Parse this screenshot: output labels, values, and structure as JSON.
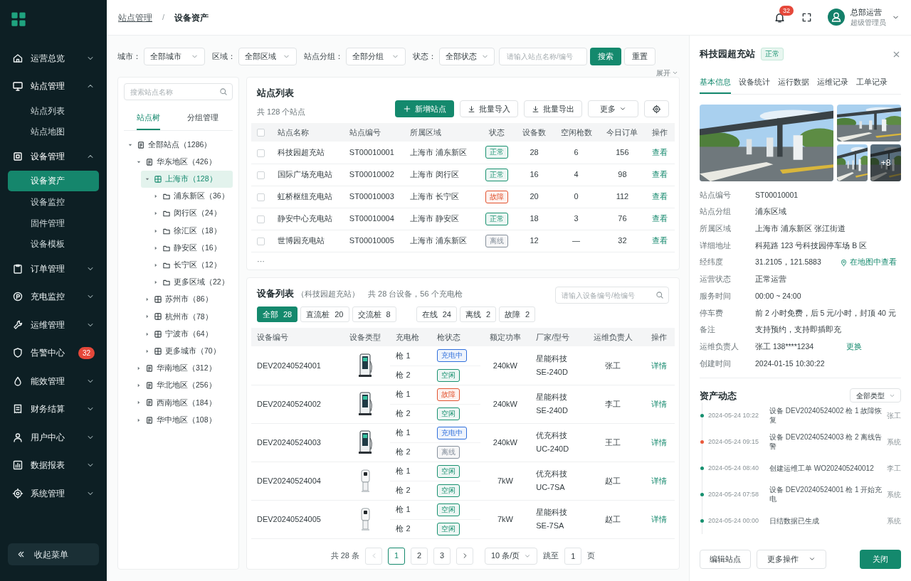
{
  "sidebar": {
    "items": [
      {
        "label": "运营总览",
        "expanded": false
      },
      {
        "label": "站点管理",
        "expanded": true,
        "children": [
          {
            "label": "站点列表",
            "selected": false
          },
          {
            "label": "站点地图",
            "selected": false
          }
        ]
      },
      {
        "label": "设备管理",
        "expanded": true,
        "children": [
          {
            "label": "设备资产",
            "selected": true
          },
          {
            "label": "设备监控",
            "selected": false
          },
          {
            "label": "固件管理",
            "selected": false
          },
          {
            "label": "设备模板",
            "selected": false
          }
        ]
      },
      {
        "label": "订单管理",
        "expanded": false
      },
      {
        "label": "充电监控",
        "expanded": false
      },
      {
        "label": "运维管理",
        "expanded": false
      },
      {
        "label": "告警中心",
        "badge": "32"
      },
      {
        "label": "能效管理",
        "expanded": false
      },
      {
        "label": "财务结算",
        "expanded": false
      },
      {
        "label": "用户中心",
        "expanded": false
      },
      {
        "label": "数据报表",
        "expanded": false
      },
      {
        "label": "系统管理",
        "expanded": false
      }
    ],
    "collapse_label": "收起菜单"
  },
  "header": {
    "breadcrumb": [
      "站点管理",
      "设备资产"
    ],
    "separator": "/",
    "notification_count": "32",
    "user": {
      "name": "总部运营",
      "role": "超级管理员"
    }
  },
  "filters": {
    "fields": [
      {
        "label": "城市：",
        "value": "全部城市"
      },
      {
        "label": "区域：",
        "value": "全部区域"
      },
      {
        "label": "站点分组：",
        "value": "全部分组"
      },
      {
        "label": "状态：",
        "value": "全部状态"
      }
    ],
    "search_placeholder": "请输入站点名称/编号",
    "search_button": "搜索",
    "reset_button": "重置",
    "expand_label": "展开"
  },
  "tree": {
    "search_placeholder": "搜索站点名称",
    "tabs": [
      {
        "label": "站点树",
        "selected": true
      },
      {
        "label": "分组管理",
        "selected": false
      }
    ],
    "nodes": [
      {
        "label": "全部站点（1286）",
        "expanded": true,
        "selected": false,
        "children": [
          {
            "label": "华东地区（426）",
            "expanded": true,
            "selected": false,
            "children": [
              {
                "label": "上海市（128）",
                "expanded": true,
                "selected": true,
                "children": [
                  {
                    "label": "浦东新区（36）",
                    "expanded": false,
                    "selected": false
                  },
                  {
                    "label": "闵行区（24）",
                    "expanded": false,
                    "selected": false
                  },
                  {
                    "label": "徐汇区（18）",
                    "expanded": false,
                    "selected": false
                  },
                  {
                    "label": "静安区（16）",
                    "expanded": false,
                    "selected": false
                  },
                  {
                    "label": "长宁区（12）",
                    "expanded": false,
                    "selected": false
                  },
                  {
                    "label": "更多区域（22）",
                    "expanded": false,
                    "selected": false
                  }
                ]
              },
              {
                "label": "苏州市（86）",
                "expanded": false,
                "selected": false
              },
              {
                "label": "杭州市（78）",
                "expanded": false,
                "selected": false
              },
              {
                "label": "宁波市（64）",
                "expanded": false,
                "selected": false
              },
              {
                "label": "更多城市（70）",
                "expanded": false,
                "selected": false
              }
            ]
          },
          {
            "label": "华南地区（312）",
            "expanded": false,
            "selected": false
          },
          {
            "label": "华北地区（256）",
            "expanded": false,
            "selected": false
          },
          {
            "label": "西南地区（184）",
            "expanded": false,
            "selected": false
          },
          {
            "label": "华中地区（108）",
            "expanded": false,
            "selected": false
          }
        ]
      }
    ]
  },
  "station_list": {
    "title": "站点列表",
    "summary": "共 128 个站点",
    "add_button": "新增站点",
    "import_button": "批量导入",
    "export_button": "批量导出",
    "more_button": "更多",
    "all_checked": false,
    "columns": [
      "站点名称",
      "站点编号",
      "所属区域",
      "状态",
      "设备数",
      "空闲枪数",
      "今日订单",
      "操作"
    ],
    "rows": [
      {
        "checked": false,
        "name": "科技园超充站",
        "code": "ST00010001",
        "area": "上海市 浦东新区",
        "status": "正常",
        "color": "#17916f",
        "devices": "28",
        "idle_guns": "6",
        "orders": "156",
        "action": "查看"
      },
      {
        "checked": false,
        "name": "国际广场充电站",
        "code": "ST00010002",
        "area": "上海市 闵行区",
        "status": "正常",
        "color": "#17916f",
        "devices": "16",
        "idle_guns": "4",
        "orders": "98",
        "action": "查看"
      },
      {
        "checked": false,
        "name": "虹桥枢纽充电站",
        "code": "ST00010003",
        "area": "上海市 长宁区",
        "status": "故障",
        "color": "#e2532f",
        "devices": "20",
        "idle_guns": "0",
        "orders": "112",
        "action": "查看"
      },
      {
        "checked": false,
        "name": "静安中心充电站",
        "code": "ST00010004",
        "area": "上海市 静安区",
        "status": "正常",
        "color": "#17916f",
        "devices": "18",
        "idle_guns": "3",
        "orders": "76",
        "action": "查看"
      },
      {
        "checked": false,
        "name": "世博园充电站",
        "code": "ST00010005",
        "area": "上海市 浦东新区",
        "status": "离线",
        "color": "#86909c",
        "devices": "12",
        "idle_guns": "—",
        "orders": "32",
        "action": "查看"
      }
    ],
    "more": "···"
  },
  "device_list": {
    "title": "设备列表",
    "subtitle": "（科技园超充站）",
    "summary": "共 28 台设备，56 个充电枪",
    "search_placeholder": "请输入设备编号/枪编号",
    "type_filters": [
      {
        "label": "全部",
        "count": "28",
        "selected": true
      },
      {
        "label": "直流桩",
        "count": "20",
        "selected": false
      },
      {
        "label": "交流桩",
        "count": "8",
        "selected": false
      }
    ],
    "state_filters": [
      {
        "label": "在线",
        "count": "24",
        "selected": false
      },
      {
        "label": "离线",
        "count": "2",
        "selected": false
      },
      {
        "label": "故障",
        "count": "2",
        "selected": false
      }
    ],
    "columns": [
      "设备编号",
      "设备类型",
      "充电枪",
      "枪状态",
      "额定功率",
      "厂家/型号",
      "运维负责人",
      "操作"
    ],
    "rows": [
      {
        "code": "DEV20240524001",
        "kind": "dc",
        "guns": [
          {
            "label": "枪 1",
            "status": "充电中",
            "color": "#2f6fdc"
          },
          {
            "label": "枪 2",
            "status": "空闲",
            "color": "#17916f"
          }
        ],
        "power": "240kW",
        "maker": "星能科技",
        "model": "SE-240D",
        "owner": "张工",
        "action": "详情"
      },
      {
        "code": "DEV20240524002",
        "kind": "dc",
        "guns": [
          {
            "label": "枪 1",
            "status": "故障",
            "color": "#e2532f"
          },
          {
            "label": "枪 2",
            "status": "空闲",
            "color": "#17916f"
          }
        ],
        "power": "240kW",
        "maker": "星能科技",
        "model": "SE-240D",
        "owner": "李工",
        "action": "详情"
      },
      {
        "code": "DEV20240524003",
        "kind": "dc",
        "guns": [
          {
            "label": "枪 1",
            "status": "充电中",
            "color": "#2f6fdc"
          },
          {
            "label": "枪 2",
            "status": "离线",
            "color": "#86909c"
          }
        ],
        "power": "240kW",
        "maker": "优充科技",
        "model": "UC-240D",
        "owner": "王工",
        "action": "详情"
      },
      {
        "code": "DEV20240524004",
        "kind": "ac",
        "guns": [
          {
            "label": "枪 1",
            "status": "空闲",
            "color": "#17916f"
          },
          {
            "label": "枪 2",
            "status": "空闲",
            "color": "#17916f"
          }
        ],
        "power": "7kW",
        "maker": "优充科技",
        "model": "UC-7SA",
        "owner": "赵工",
        "action": "详情"
      },
      {
        "code": "DEV20240524005",
        "kind": "ac",
        "guns": [
          {
            "label": "枪 1",
            "status": "空闲",
            "color": "#17916f"
          },
          {
            "label": "枪 2",
            "status": "空闲",
            "color": "#17916f"
          }
        ],
        "power": "7kW",
        "maker": "星能科技",
        "model": "SE-7SA",
        "owner": "赵工",
        "action": "详情"
      }
    ],
    "pagination": {
      "total": "共 28 条",
      "prev_disabled": true,
      "pages": [
        {
          "label": "1",
          "selected": true
        },
        {
          "label": "2",
          "selected": false
        },
        {
          "label": "3",
          "selected": false
        }
      ],
      "page_size": "10 条/页",
      "jump_label": "跳至",
      "jump_value": "1",
      "page_suffix": "页"
    }
  },
  "detail": {
    "title": "科技园超充站",
    "status": "正常",
    "tabs": [
      {
        "label": "基本信息",
        "selected": true
      },
      {
        "label": "设备统计",
        "selected": false
      },
      {
        "label": "运行数据",
        "selected": false
      },
      {
        "label": "运维记录",
        "selected": false
      },
      {
        "label": "工单记录",
        "selected": false
      }
    ],
    "gallery_more": "+8",
    "fields": [
      {
        "label": "站点编号",
        "value": "ST00010001"
      },
      {
        "label": "站点分组",
        "value": "浦东区域"
      },
      {
        "label": "所属区域",
        "value": "上海市 浦东新区 张江街道"
      },
      {
        "label": "详细地址",
        "value": "科苑路 123 号科技园停车场 B 区"
      },
      {
        "label": "经纬度",
        "value": "31.2105，121.5883",
        "link": "在地图中查看",
        "kind": "map_link"
      },
      {
        "label": "运营状态",
        "value": "正常运营"
      },
      {
        "label": "服务时间",
        "value": "00:00 ~ 24:00"
      },
      {
        "label": "停车费",
        "value": "前 2 小时免费，后 5 元/小时，封顶 40 元"
      },
      {
        "label": "备注",
        "value": "支持预约，支持即插即充"
      },
      {
        "label": "运维负责人",
        "value": "张工   138****1234",
        "link": "更换",
        "kind": "link"
      },
      {
        "label": "创建时间",
        "value": "2024-01-15 10:30:22"
      }
    ],
    "activity": {
      "title": "资产动态",
      "filter": "全部类型",
      "items": [
        {
          "time": "2024-05-24 10:22",
          "text": "设备 DEV20240524002 枪 1 故障恢复",
          "user": "张工",
          "color": "#16906f"
        },
        {
          "time": "2024-05-24 09:15",
          "text": "设备 DEV20240524003 枪 2 离线告警",
          "user": "系统",
          "color": "#ea5a3c"
        },
        {
          "time": "2024-05-24 08:40",
          "text": "创建运维工单 WO202405240012",
          "user": "李工",
          "color": "#16906f"
        },
        {
          "time": "2024-05-24 07:58",
          "text": "设备 DEV20240524001 枪 1 开始充电",
          "user": "系统",
          "color": "#16906f"
        },
        {
          "time": "2024-05-24 00:00",
          "text": "日结数据已生成",
          "user": "系统",
          "color": "#16906f"
        }
      ]
    },
    "edit_button": "编辑站点",
    "more_button": "更多操作",
    "close_button": "关闭"
  }
}
